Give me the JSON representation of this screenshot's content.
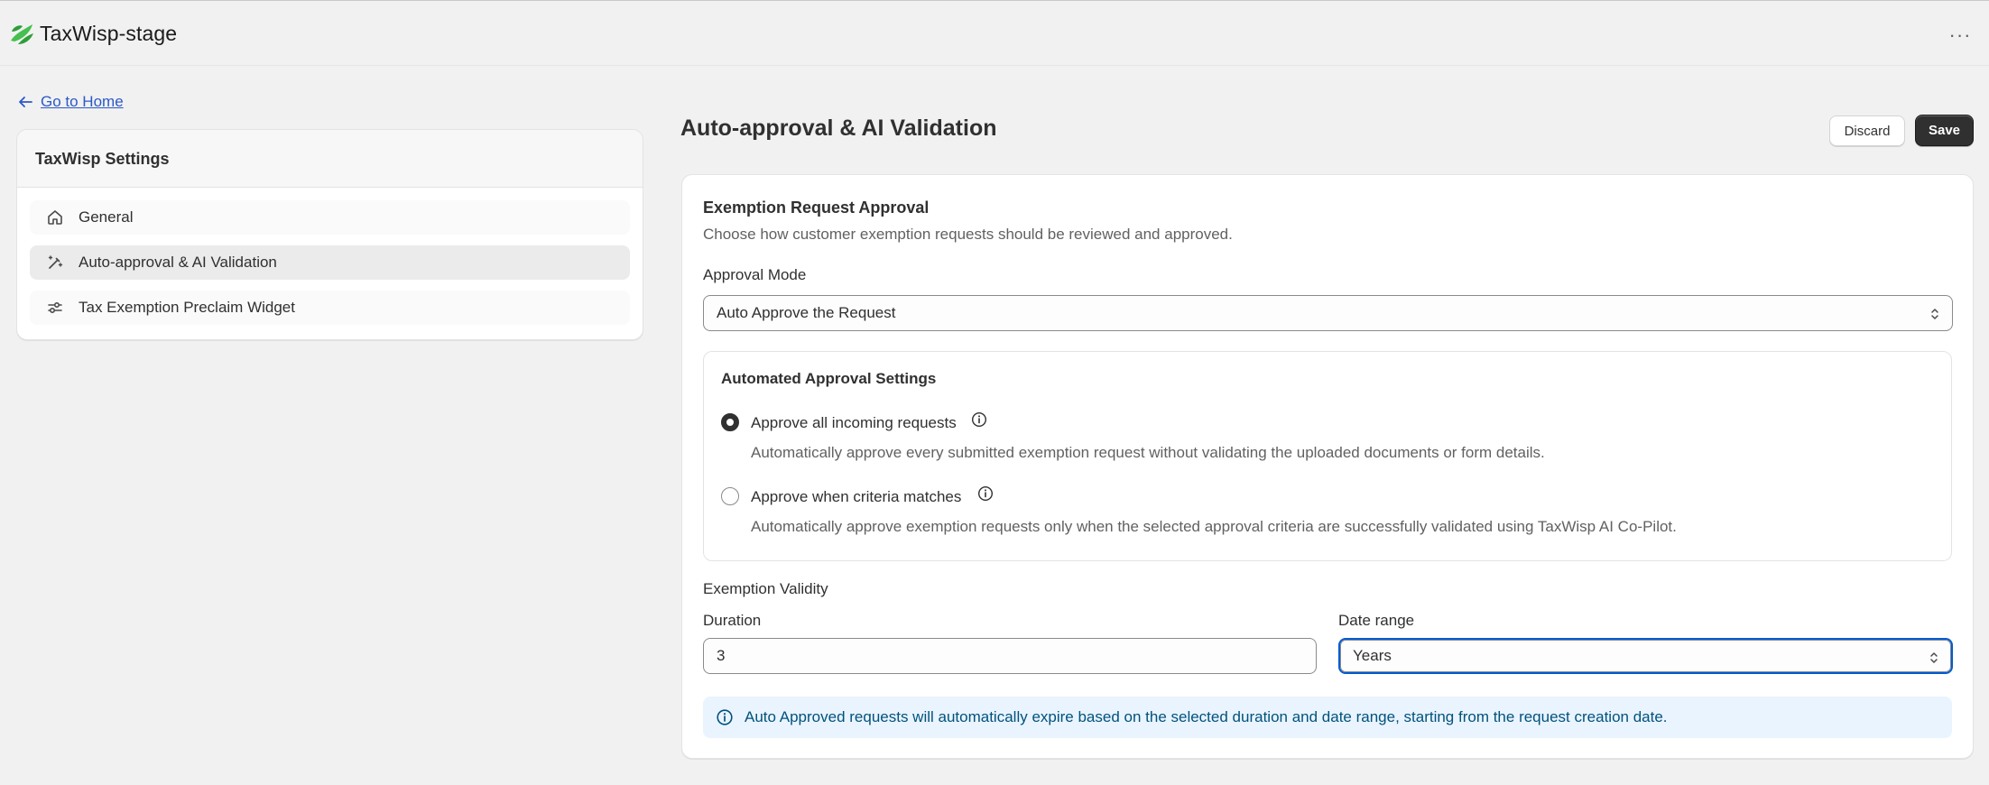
{
  "app": {
    "title": "TaxWisp-stage"
  },
  "nav": {
    "back_label": "Go to Home"
  },
  "settings": {
    "title": "TaxWisp Settings",
    "items": [
      {
        "label": "General",
        "icon": "home-icon"
      },
      {
        "label": "Auto-approval & AI Validation",
        "icon": "magic-wand-icon",
        "active": true
      },
      {
        "label": "Tax Exemption Preclaim Widget",
        "icon": "sliders-icon"
      }
    ]
  },
  "page": {
    "title": "Auto-approval & AI Validation",
    "discard_label": "Discard",
    "save_label": "Save"
  },
  "exemption_request": {
    "title": "Exemption Request Approval",
    "description": "Choose how customer exemption requests should be reviewed and approved.",
    "approval_mode_label": "Approval Mode",
    "approval_mode_value": "Auto Approve the Request"
  },
  "automated": {
    "title": "Automated Approval Settings",
    "options": [
      {
        "label": "Approve all incoming requests",
        "help": "Automatically approve every submitted exemption request without validating the uploaded documents or form details.",
        "checked": true
      },
      {
        "label": "Approve when criteria matches",
        "help": "Automatically approve exemption requests only when the selected approval criteria are successfully validated using TaxWisp AI Co-Pilot.",
        "checked": false
      }
    ]
  },
  "validity": {
    "title": "Exemption Validity",
    "duration_label": "Duration",
    "duration_value": "3",
    "date_range_label": "Date range",
    "date_range_value": "Years",
    "banner": "Auto Approved requests will automatically expire based on the selected duration and date range, starting from the request creation date."
  },
  "colors": {
    "brand_green": "#3bb143",
    "primary_button": "#303030",
    "link": "#2c59c7",
    "info_banner_bg": "#eaf4ff",
    "focus": "#005bd3"
  }
}
